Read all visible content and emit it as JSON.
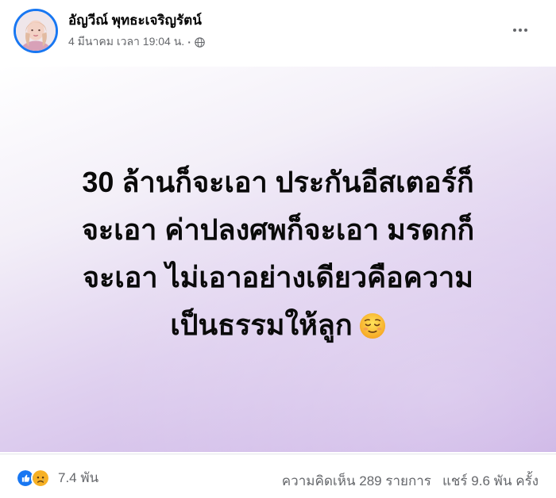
{
  "post": {
    "author": "อัญวีณ์ พุทธะเจริญรัตน์",
    "timestamp": "4 มีนาคม เวลา 19:04 น.",
    "separator": "·",
    "privacy_icon": "globe-icon",
    "more_icon": "more-options-icon",
    "text_lines": [
      "30 ล้านก็จะเอา ประกันอีสเตอร์ก็",
      "จะเอา ค่าปลงศพก็จะเอา มรดกก็",
      "จะเอา ไม่เอาอย่างเดียวคือความ",
      "เป็นธรรมให้ลูก"
    ],
    "emoji": "relieved-face-emoji",
    "background_colors": [
      "#ffffff",
      "#c8aee4"
    ]
  },
  "footer": {
    "reaction_icons": [
      "like-icon",
      "sad-icon"
    ],
    "reaction_count": "7.4 พัน",
    "comments": "ความคิดเห็น 289 รายการ",
    "shares": "แชร์ 9.6 พัน ครั้ง"
  },
  "colors": {
    "accent": "#1877f2",
    "secondary_text": "#65676b",
    "sad_yellow": "#f7b125"
  }
}
